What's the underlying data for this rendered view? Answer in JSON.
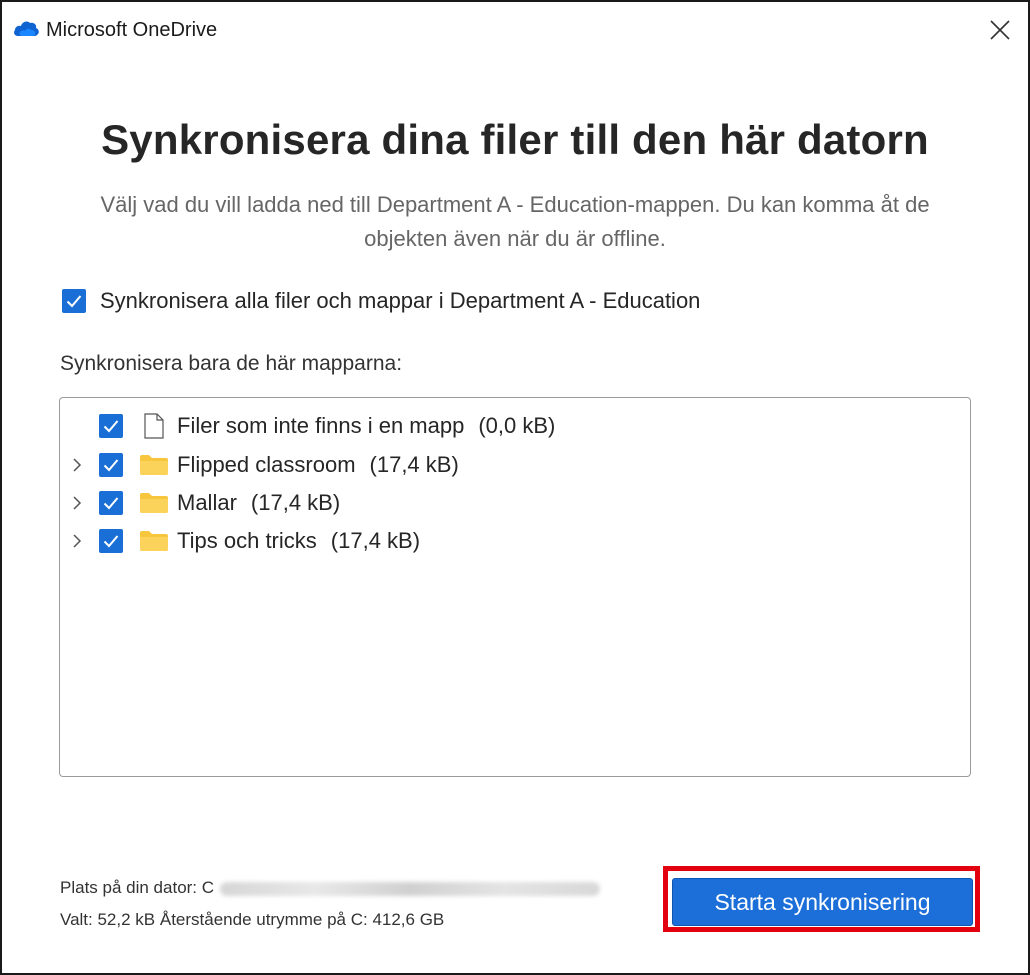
{
  "window": {
    "title": "Microsoft OneDrive"
  },
  "heading": "Synkronisera dina filer till den här datorn",
  "subtext": "Välj vad du vill ladda ned till Department A - Education-mappen. Du kan komma åt de objekten även när du är offline.",
  "sync_all": {
    "label": "Synkronisera alla filer och mappar i Department A - Education",
    "checked": true
  },
  "section_label": "Synkronisera bara de här mapparna:",
  "tree": [
    {
      "label": "Filer som inte finns i en mapp",
      "size": "(0,0 kB)",
      "icon": "file-icon",
      "expandable": false,
      "checked": true
    },
    {
      "label": "Flipped classroom",
      "size": "(17,4 kB)",
      "icon": "folder-icon",
      "expandable": true,
      "checked": true
    },
    {
      "label": "Mallar",
      "size": "(17,4 kB)",
      "icon": "folder-icon",
      "expandable": true,
      "checked": true
    },
    {
      "label": "Tips och tricks",
      "size": "(17,4 kB)",
      "icon": "folder-icon",
      "expandable": true,
      "checked": true
    }
  ],
  "footer": {
    "location_label": "Plats på din dator: C",
    "selection_info": "Valt: 52,2 kB Återstående utrymme på C: 412,6 GB"
  },
  "buttons": {
    "start_sync": "Starta synkronisering"
  },
  "colors": {
    "accent": "#1a6fd6",
    "highlight": "#e3000f",
    "folder": "#f8c63d"
  }
}
